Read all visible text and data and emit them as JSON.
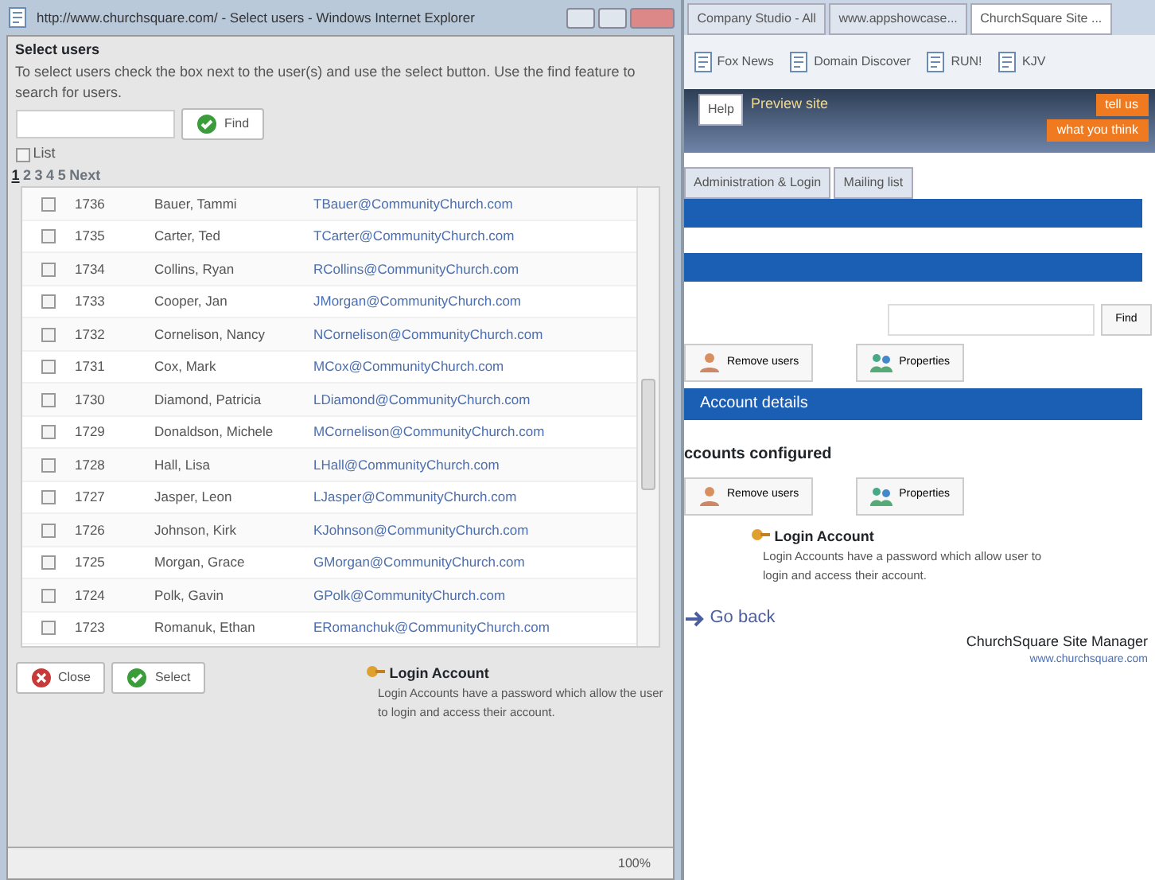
{
  "popup": {
    "title": "http://www.churchsquare.com/ - Select users - Windows Internet Explorer",
    "heading": "Select users",
    "instructions": "To select users check the box next to the user(s) and use the select button. Use the find feature to search for users.",
    "find_button": "Find",
    "list_option": {
      "label": "List",
      "checked": false
    },
    "pages": [
      {
        "label": "1",
        "selected": true
      },
      {
        "label": "2",
        "selected": false
      },
      {
        "label": "3",
        "selected": false
      },
      {
        "label": "4",
        "selected": false
      },
      {
        "label": "5",
        "selected": false
      },
      {
        "label": "Next",
        "selected": false
      }
    ],
    "rows": [
      {
        "checked": false,
        "id": "1736",
        "name": "Bauer, Tammi",
        "email": "TBauer@CommunityChurch.com"
      },
      {
        "checked": false,
        "id": "1735",
        "name": "Carter, Ted",
        "email": "TCarter@CommunityChurch.com"
      },
      {
        "checked": false,
        "id": "1734",
        "name": "Collins, Ryan",
        "email": "RCollins@CommunityChurch.com"
      },
      {
        "checked": false,
        "id": "1733",
        "name": "Cooper, Jan",
        "email": "JMorgan@CommunityChurch.com"
      },
      {
        "checked": false,
        "id": "1732",
        "name": "Cornelison, Nancy",
        "email": "NCornelison@CommunityChurch.com"
      },
      {
        "checked": false,
        "id": "1731",
        "name": "Cox, Mark",
        "email": "MCox@CommunityChurch.com"
      },
      {
        "checked": false,
        "id": "1730",
        "name": "Diamond, Patricia",
        "email": "LDiamond@CommunityChurch.com"
      },
      {
        "checked": false,
        "id": "1729",
        "name": "Donaldson, Michele",
        "email": "MCornelison@CommunityChurch.com"
      },
      {
        "checked": false,
        "id": "1728",
        "name": "Hall, Lisa",
        "email": "LHall@CommunityChurch.com"
      },
      {
        "checked": false,
        "id": "1727",
        "name": "Jasper, Leon",
        "email": "LJasper@CommunityChurch.com"
      },
      {
        "checked": false,
        "id": "1726",
        "name": "Johnson, Kirk",
        "email": "KJohnson@CommunityChurch.com"
      },
      {
        "checked": false,
        "id": "1725",
        "name": "Morgan, Grace",
        "email": "GMorgan@CommunityChurch.com"
      },
      {
        "checked": false,
        "id": "1724",
        "name": "Polk, Gavin",
        "email": "GPolk@CommunityChurch.com"
      },
      {
        "checked": false,
        "id": "1723",
        "name": "Romanuk, Ethan",
        "email": "ERomanchuk@CommunityChurch.com"
      }
    ],
    "close_button": "Close",
    "select_button": "Select",
    "info": {
      "title": "Login Account",
      "text": "Login Accounts have a password which allow the user to login and access their account."
    },
    "zoom": "100%"
  },
  "page": {
    "browser_tabs": [
      {
        "label": "Company Studio - All",
        "selected": false
      },
      {
        "label": "www.appshowcase...",
        "selected": false
      },
      {
        "label": "ChurchSquare Site ...",
        "selected": true
      }
    ],
    "favorites": [
      "Fox News",
      "Domain Discover",
      "RUN!",
      "KJV"
    ],
    "nav_tab": "Help",
    "preview_link": "Preview site",
    "feedback": [
      "tell us",
      "what you think"
    ],
    "section_tabs": [
      "Administration & Login",
      "Mailing list"
    ],
    "find_button": "Find",
    "actions_1": [
      "Remove users",
      "Properties"
    ],
    "account_header": "Account details",
    "configured_heading": "ccounts configured",
    "actions_2": [
      "Remove users",
      "Properties"
    ],
    "info": {
      "title": "Login Account",
      "text": "Login Accounts have a password which allow user to login and access their account."
    },
    "back_link": "Go back",
    "footer_title": "ChurchSquare Site Manager",
    "footer_link": "www.churchsquare.com"
  }
}
